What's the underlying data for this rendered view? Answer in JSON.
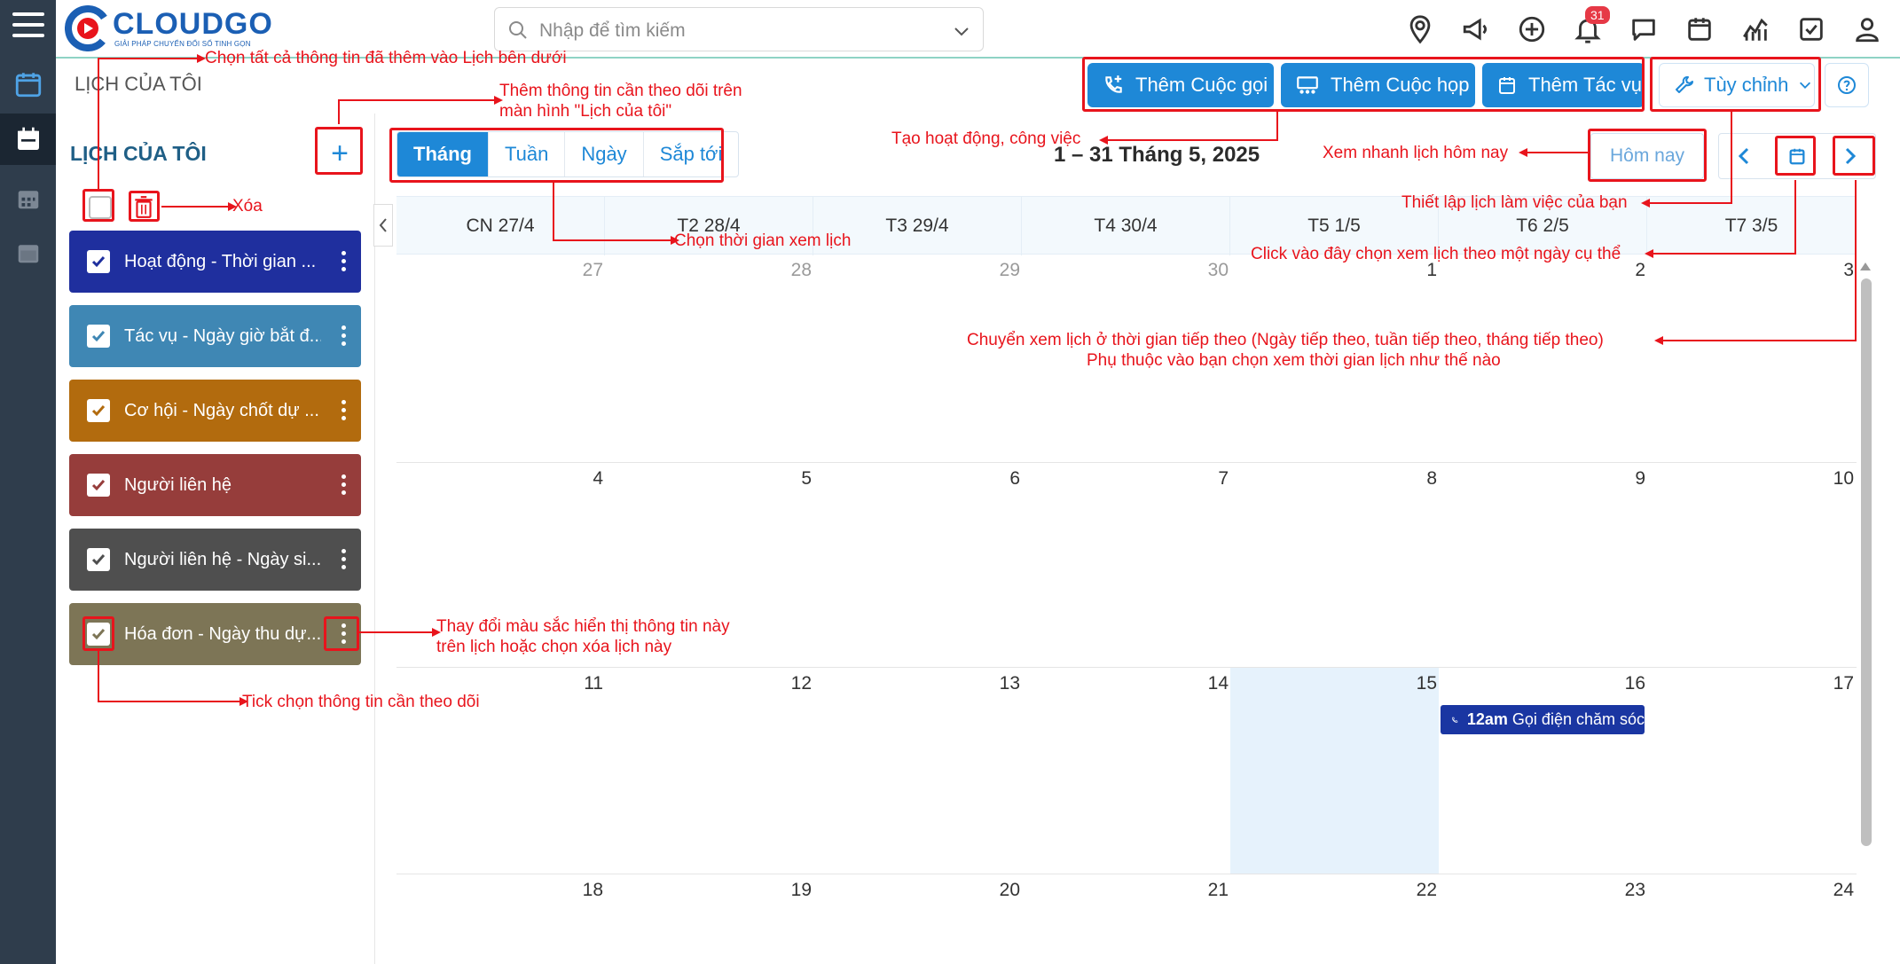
{
  "brand": {
    "name": "CLOUDGO",
    "tagline": "GIẢI PHÁP CHUYỂN ĐỔI SỐ TINH GỌN"
  },
  "search": {
    "placeholder": "Nhập để tìm kiếm"
  },
  "header": {
    "notification_count": "31"
  },
  "page": {
    "title": "LỊCH CỦA TÔI"
  },
  "actions": {
    "add_call": "Thêm Cuộc gọi",
    "add_meeting": "Thêm Cuộc họp",
    "add_task": "Thêm Tác vụ",
    "customize": "Tùy chỉnh"
  },
  "sidebar": {
    "title": "LỊCH CỦA TÔI",
    "items": [
      {
        "label": "Hoạt động - Thời gian ...",
        "color": "#1f2f9e"
      },
      {
        "label": "Tác vụ - Ngày giờ bắt đ...",
        "color": "#3f87b4"
      },
      {
        "label": "Cơ hội - Ngày chốt dự ...",
        "color": "#b26b0e"
      },
      {
        "label": "Người liên hệ",
        "color": "#963d3b"
      },
      {
        "label": "Người liên hệ - Ngày si...",
        "color": "#4f4f4f"
      },
      {
        "label": "Hóa đơn - Ngày thu dự...",
        "color": "#7d7556"
      }
    ]
  },
  "calendar": {
    "views": [
      "Tháng",
      "Tuần",
      "Ngày",
      "Sắp tới"
    ],
    "active_view": "Tháng",
    "range": "1 – 31 Tháng 5, 2025",
    "today_label": "Hôm nay",
    "columns": [
      "CN 27/4",
      "T2 28/4",
      "T3 29/4",
      "T4 30/4",
      "T5 1/5",
      "T6 2/5",
      "T7 3/5"
    ],
    "weeks": [
      [
        "27",
        "28",
        "29",
        "30",
        "1",
        "2",
        "3"
      ],
      [
        "4",
        "5",
        "6",
        "7",
        "8",
        "9",
        "10"
      ],
      [
        "11",
        "12",
        "13",
        "14",
        "15",
        "16",
        "17"
      ],
      [
        "18",
        "19",
        "20",
        "21",
        "22",
        "23",
        "24"
      ]
    ],
    "event": {
      "time": "12am",
      "title": "Gọi điện chăm sóc"
    }
  },
  "annotations": {
    "select_all": "Chọn tất cả thông tin đã thêm vào Lịch bên dưới",
    "add_info_1": "Thêm thông tin cần theo dõi trên",
    "add_info_2": "màn hình \"Lịch của tôi\"",
    "delete": "Xóa",
    "create_activity": "Tạo hoạt động, công việc",
    "quick_today": "Xem nhanh lịch hôm nay",
    "set_schedule": "Thiết lập lịch làm việc của bạn",
    "pick_view": "Chọn thời gian xem lịch",
    "pick_date": "Click vào đây chọn xem lịch theo một ngày cụ thể",
    "next_1": "Chuyển xem lịch ở thời gian tiếp theo (Ngày tiếp theo, tuần tiếp theo, tháng tiếp theo)",
    "next_2": "Phụ thuộc vào bạn chọn xem thời gian lịch như thế nào",
    "change_color_1": "Thay đổi màu sắc hiển thị thông tin này",
    "change_color_2": "trên lịch hoặc chọn xóa lịch này",
    "tick": "Tick chọn thông tin cần theo dõi"
  }
}
